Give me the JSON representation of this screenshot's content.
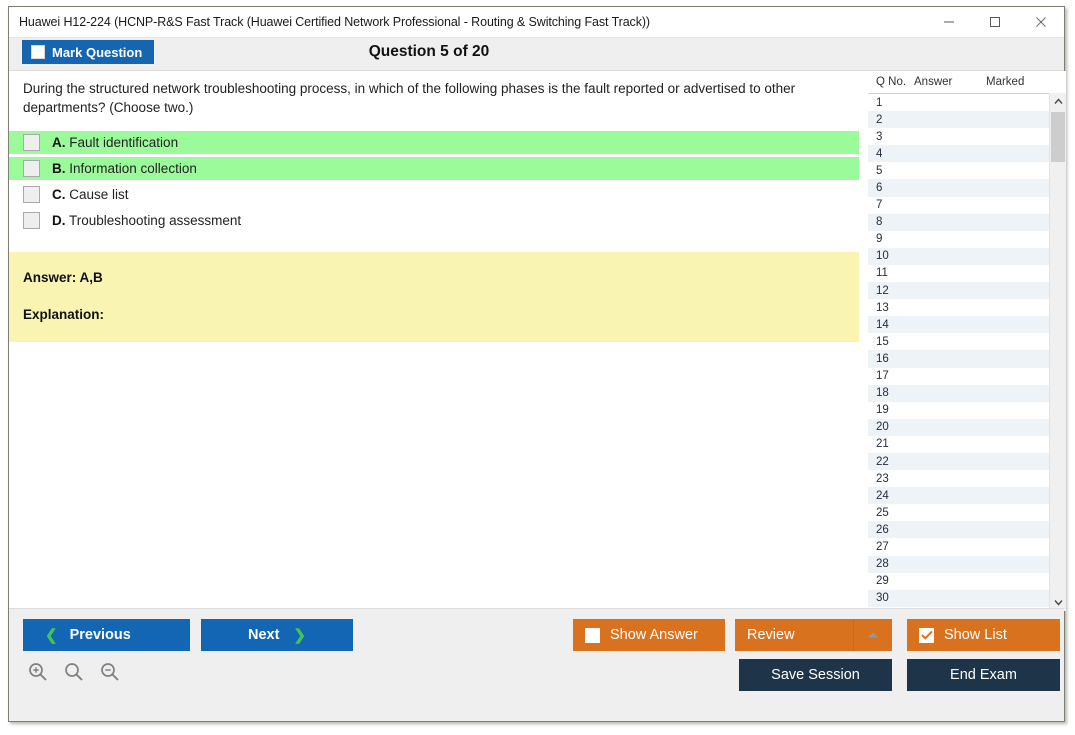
{
  "window": {
    "title": "Huawei H12-224 (HCNP-R&S Fast Track (Huawei Certified Network Professional - Routing & Switching Fast Track))",
    "controls": {
      "minimize": "minimize-icon",
      "maximize": "maximize-icon",
      "close": "close-icon"
    }
  },
  "toolbar": {
    "mark_label": "Mark Question",
    "question_title": "Question 5 of 20"
  },
  "question": {
    "text": "During the structured network troubleshooting process, in which of the following phases is the fault reported or advertised to other departments? (Choose two.)",
    "options": [
      {
        "letter": "A.",
        "text": "Fault identification",
        "highlighted": true
      },
      {
        "letter": "B.",
        "text": "Information collection",
        "highlighted": true
      },
      {
        "letter": "C.",
        "text": "Cause list",
        "highlighted": false
      },
      {
        "letter": "D.",
        "text": "Troubleshooting assessment",
        "highlighted": false
      }
    ],
    "answer_label": "Answer: A,B",
    "explanation_label": "Explanation:"
  },
  "question_list": {
    "headers": [
      "Q No.",
      "Answer",
      "Marked"
    ],
    "rows": [
      {
        "no": "1",
        "answer": "",
        "marked": ""
      },
      {
        "no": "2",
        "answer": "",
        "marked": ""
      },
      {
        "no": "3",
        "answer": "",
        "marked": ""
      },
      {
        "no": "4",
        "answer": "",
        "marked": ""
      },
      {
        "no": "5",
        "answer": "",
        "marked": ""
      },
      {
        "no": "6",
        "answer": "",
        "marked": ""
      },
      {
        "no": "7",
        "answer": "",
        "marked": ""
      },
      {
        "no": "8",
        "answer": "",
        "marked": ""
      },
      {
        "no": "9",
        "answer": "",
        "marked": ""
      },
      {
        "no": "10",
        "answer": "",
        "marked": ""
      },
      {
        "no": "11",
        "answer": "",
        "marked": ""
      },
      {
        "no": "12",
        "answer": "",
        "marked": ""
      },
      {
        "no": "13",
        "answer": "",
        "marked": ""
      },
      {
        "no": "14",
        "answer": "",
        "marked": ""
      },
      {
        "no": "15",
        "answer": "",
        "marked": ""
      },
      {
        "no": "16",
        "answer": "",
        "marked": ""
      },
      {
        "no": "17",
        "answer": "",
        "marked": ""
      },
      {
        "no": "18",
        "answer": "",
        "marked": ""
      },
      {
        "no": "19",
        "answer": "",
        "marked": ""
      },
      {
        "no": "20",
        "answer": "",
        "marked": ""
      },
      {
        "no": "21",
        "answer": "",
        "marked": ""
      },
      {
        "no": "22",
        "answer": "",
        "marked": ""
      },
      {
        "no": "23",
        "answer": "",
        "marked": ""
      },
      {
        "no": "24",
        "answer": "",
        "marked": ""
      },
      {
        "no": "25",
        "answer": "",
        "marked": ""
      },
      {
        "no": "26",
        "answer": "",
        "marked": ""
      },
      {
        "no": "27",
        "answer": "",
        "marked": ""
      },
      {
        "no": "28",
        "answer": "",
        "marked": ""
      },
      {
        "no": "29",
        "answer": "",
        "marked": ""
      },
      {
        "no": "30",
        "answer": "",
        "marked": ""
      }
    ]
  },
  "footer": {
    "previous_label": "Previous",
    "next_label": "Next",
    "show_answer_label": "Show Answer",
    "show_answer_checked": false,
    "review_label": "Review",
    "show_list_label": "Show List",
    "show_list_checked": true,
    "save_session_label": "Save Session",
    "end_exam_label": "End Exam",
    "zoom_icons": [
      "zoom-in-icon",
      "zoom-reset-icon",
      "zoom-out-icon"
    ]
  },
  "colors": {
    "primary_blue": "#1266b3",
    "orange": "#d9721e",
    "dark_navy": "#1e3449",
    "highlight_green": "#9bfb9b",
    "answer_yellow": "#faf4b3",
    "chevron_green": "#44c553"
  }
}
